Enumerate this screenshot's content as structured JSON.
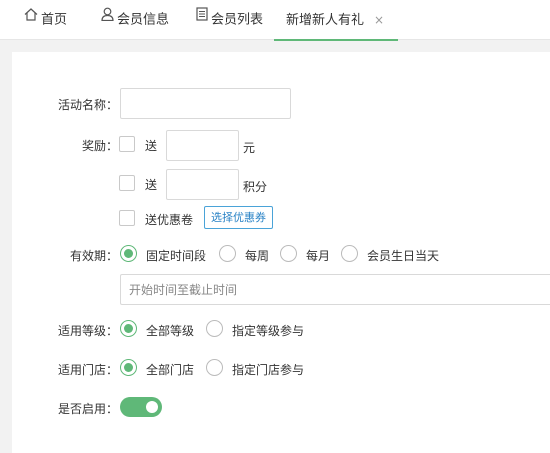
{
  "tabs": [
    {
      "label": "首页",
      "icon": "home-icon"
    },
    {
      "label": "会员信息",
      "icon": "user-icon"
    },
    {
      "label": "会员列表",
      "icon": "list-icon"
    },
    {
      "label": "新增新人有礼",
      "close": "×",
      "active": true
    }
  ],
  "form": {
    "activity_name": {
      "label": "活动名称：",
      "value": ""
    },
    "reward": {
      "label": "奖励：",
      "yuan": {
        "prefix": "送",
        "unit": "元",
        "value": "",
        "checked": false
      },
      "points": {
        "prefix": "送",
        "unit": "积分",
        "value": "",
        "checked": false
      },
      "coupon": {
        "label": "送优惠卷",
        "button": "选择优惠券",
        "checked": false
      }
    },
    "validity": {
      "label": "有效期：",
      "options": [
        "固定时间段",
        "每周",
        "每月",
        "会员生日当天"
      ],
      "selected": "固定时间段",
      "range_placeholder": "开始时间至截止时间"
    },
    "level": {
      "label": "适用等级：",
      "options": [
        "全部等级",
        "指定等级参与"
      ],
      "selected": "全部等级"
    },
    "store": {
      "label": "适用门店：",
      "options": [
        "全部门店",
        "指定门店参与"
      ],
      "selected": "全部门店"
    },
    "enabled": {
      "label": "是否启用：",
      "value": true
    }
  },
  "colors": {
    "accent": "#5fb878",
    "link": "#2a83c6"
  }
}
